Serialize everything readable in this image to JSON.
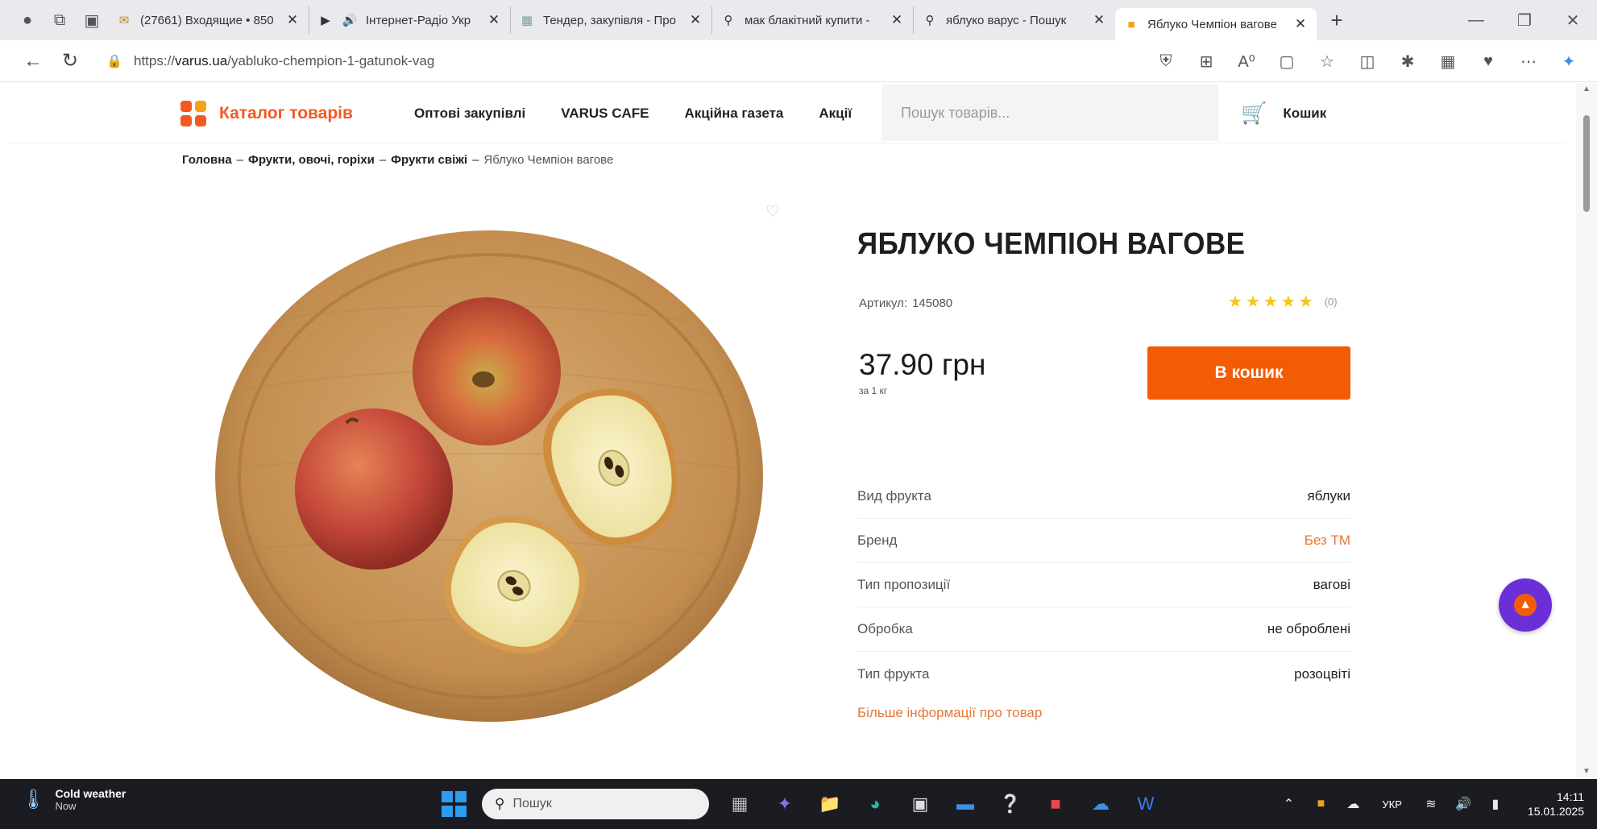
{
  "browser": {
    "tabs": [
      {
        "label": "(27661) Входящие • 850",
        "icon": "mail-icon"
      },
      {
        "label": "Інтернет-Радіо Укр",
        "icon": "radio-icon"
      },
      {
        "label": "Тендер, закупівля - Про",
        "icon": "tender-icon"
      },
      {
        "label": "мак блакітний купити -",
        "icon": "search-icon"
      },
      {
        "label": "яблуко варус - Пошук",
        "icon": "search-icon"
      },
      {
        "label": "Яблуко Чемпіон вагове",
        "icon": "varus-icon",
        "active": true
      }
    ],
    "url_prefix": "https://",
    "url_domain": "varus.ua",
    "url_path": "/yabluko-chempion-1-gatunok-vag"
  },
  "header": {
    "catalog_label": "Каталог товарів",
    "nav": [
      "Оптові закупівлі",
      "VARUS CAFE",
      "Акційна газета",
      "Акції"
    ],
    "search_placeholder": "Пошук товарів...",
    "cart_label": "Кошик"
  },
  "breadcrumbs": [
    "Головна",
    "Фрукти, овочі, горіхи",
    "Фрукти свіжі",
    "Яблуко Чемпіон вагове"
  ],
  "product": {
    "title": "ЯБЛУКО ЧЕМПІОН ВАГОВЕ",
    "sku_label": "Артикул:",
    "sku": "145080",
    "rating": 5,
    "review_count": "(0)",
    "price": "37.90 грн",
    "unit": "за 1 кг",
    "buy_label": "В кошик",
    "specs": [
      {
        "key": "Вид фрукта",
        "value": "яблуки"
      },
      {
        "key": "Бренд",
        "value": "Без ТМ",
        "link": true
      },
      {
        "key": "Тип пропозиції",
        "value": "вагові"
      },
      {
        "key": "Обробка",
        "value": "не оброблені"
      },
      {
        "key": "Тип фрукта",
        "value": "розоцвіті"
      }
    ],
    "more_label": "Більше інформації про товар"
  },
  "taskbar": {
    "weather_title": "Cold weather",
    "weather_sub": "Now",
    "search_label": "Пошук",
    "lang": "УКР",
    "time": "14:11",
    "date": "15.01.2025"
  },
  "colors": {
    "accent": "#f25c05",
    "link": "#e5763a",
    "star": "#f5c518"
  }
}
